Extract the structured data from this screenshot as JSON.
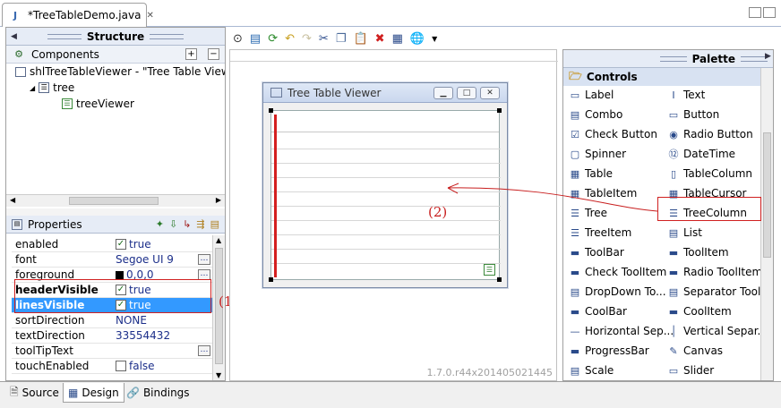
{
  "editor_tab": {
    "title": "*TreeTableDemo.java",
    "close": "✕"
  },
  "structure": {
    "title": "Structure",
    "components_label": "Components",
    "tree": [
      {
        "label": "shlTreeTableViewer - \"Tree Table View"
      },
      {
        "label": "tree"
      },
      {
        "label": "treeViewer"
      }
    ]
  },
  "properties": {
    "title": "Properties",
    "rows": [
      {
        "name": "enabled",
        "value": "true",
        "check": true
      },
      {
        "name": "font",
        "value": "Segoe UI 9",
        "dots": true
      },
      {
        "name": "foreground",
        "value": "0,0,0",
        "dots": true,
        "swatch": "#000000"
      },
      {
        "name": "headerVisible",
        "value": "true",
        "check": true,
        "bold": true
      },
      {
        "name": "linesVisible",
        "value": "true",
        "check": true,
        "bold": true,
        "selected": true
      },
      {
        "name": "sortDirection",
        "value": "NONE"
      },
      {
        "name": "textDirection",
        "value": "33554432"
      },
      {
        "name": "toolTipText",
        "value": "",
        "dots": true
      },
      {
        "name": "touchEnabled",
        "value": "false",
        "check": false
      }
    ]
  },
  "shell": {
    "title": "Tree Table Viewer"
  },
  "palette": {
    "title": "Palette",
    "category": "Controls",
    "items": [
      [
        "Label",
        "Text"
      ],
      [
        "Combo",
        "Button"
      ],
      [
        "Check Button",
        "Radio Button"
      ],
      [
        "Spinner",
        "DateTime"
      ],
      [
        "Table",
        "TableColumn"
      ],
      [
        "TableItem",
        "TableCursor"
      ],
      [
        "Tree",
        "TreeColumn"
      ],
      [
        "TreeItem",
        "List"
      ],
      [
        "ToolBar",
        "ToolItem"
      ],
      [
        "Check ToolItem",
        "Radio ToolItem"
      ],
      [
        "DropDown To...",
        "Separator Tool..."
      ],
      [
        "CoolBar",
        "CoolItem"
      ],
      [
        "Horizontal Sep...",
        "Vertical Separ..."
      ],
      [
        "ProgressBar",
        "Canvas"
      ],
      [
        "Scale",
        "Slider"
      ]
    ]
  },
  "version": "1.7.0.r44x201405021445",
  "annotations": {
    "one": "(1)",
    "two": "(2)"
  },
  "bottom_tabs": [
    {
      "label": "Source"
    },
    {
      "label": "Design"
    },
    {
      "label": "Bindings"
    }
  ],
  "colors": {
    "accent": "#3399ff",
    "annotation": "#c81e1e"
  }
}
